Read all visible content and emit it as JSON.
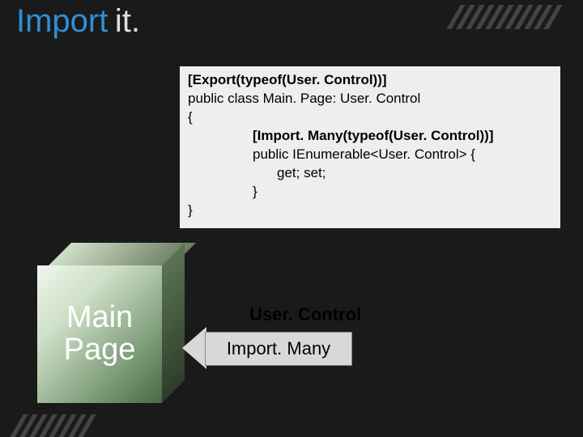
{
  "title": {
    "word1": "Import",
    "word2": "it."
  },
  "code": {
    "line1": "[Export(typeof(User. Control))]",
    "line2": "public class Main. Page: User. Control",
    "line3": "{",
    "line4": "[Import. Many(typeof(User. Control))]",
    "line5": "public IEnumerable<User. Control> {",
    "line6": "get; set;",
    "line7": "}",
    "line8": "}"
  },
  "cube": {
    "line1": "Main",
    "line2": "Page"
  },
  "label_user_control": "User. Control",
  "arrow_text": "Import. Many"
}
